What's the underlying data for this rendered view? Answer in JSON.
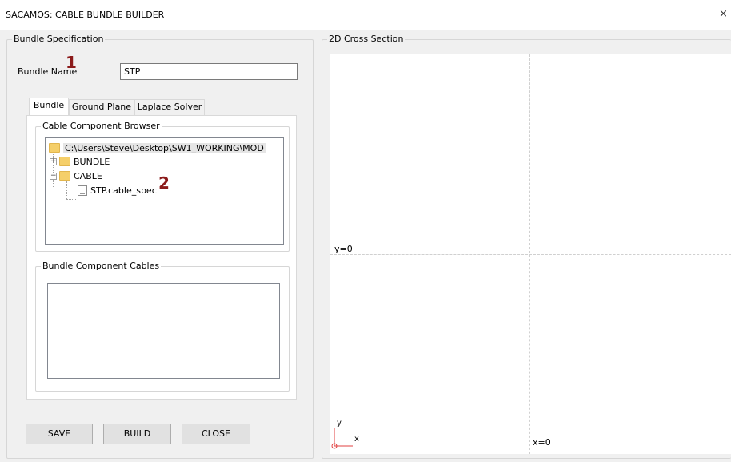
{
  "window": {
    "title": "SACAMOS: CABLE BUNDLE BUILDER",
    "close_glyph": "×"
  },
  "bundle_spec": {
    "group_label": "Bundle Specification",
    "name_label": "Bundle Name",
    "name_value": "STP",
    "marker_1": "1",
    "marker_2": "2",
    "tabs": [
      "Bundle",
      "Ground Plane",
      "Laplace Solver"
    ],
    "active_tab": "Bundle",
    "browser": {
      "group_label": "Cable Component Browser",
      "root": "C:\\Users\\Steve\\Desktop\\SW1_WORKING\\MOD",
      "items": [
        {
          "label": "BUNDLE",
          "type": "folder",
          "expander": "+"
        },
        {
          "label": "CABLE",
          "type": "folder",
          "expander": "−"
        },
        {
          "label": "STP.cable_spec",
          "type": "file"
        }
      ]
    },
    "component_cables": {
      "group_label": "Bundle Component Cables",
      "items": []
    },
    "buttons": {
      "save": "SAVE",
      "build": "BUILD",
      "close": "CLOSE"
    }
  },
  "cross_section": {
    "group_label": "2D Cross Section",
    "y_axis_label": "y=0",
    "x_axis_label": "x=0",
    "axis_icon_y": "y",
    "axis_icon_x": "x"
  }
}
